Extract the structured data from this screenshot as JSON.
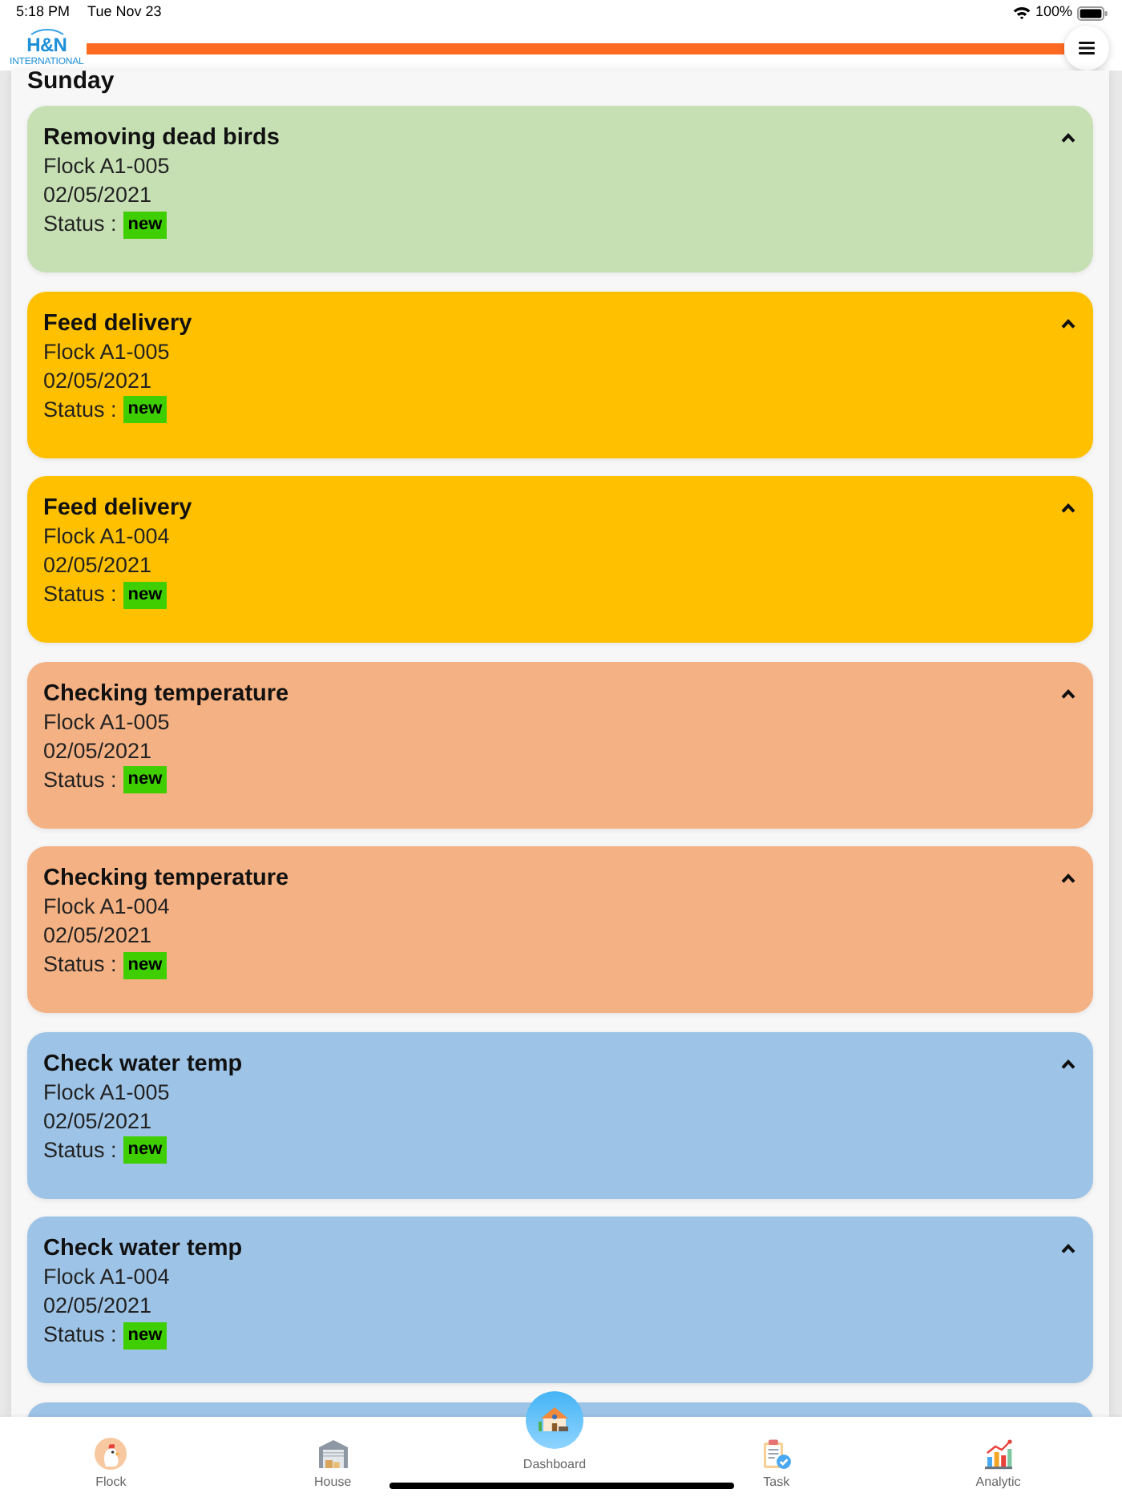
{
  "status_bar": {
    "time": "5:18 PM",
    "date": "Tue Nov 23",
    "battery": "100%"
  },
  "header": {
    "logo": "H&N",
    "logo_subtitle": "INTERNATIONAL"
  },
  "day": "Sunday",
  "cards": [
    {
      "title": "Removing dead birds",
      "flock": "Flock A1-005",
      "date": "02/05/2021",
      "status_label": "Status :",
      "status": "new",
      "color": "#c6e0b4",
      "expanded": true
    },
    {
      "title": "Feed delivery",
      "flock": "Flock A1-005",
      "date": "02/05/2021",
      "status_label": "Status :",
      "status": "new",
      "color": "#ffc000",
      "expanded": true
    },
    {
      "title": "Feed delivery",
      "flock": "Flock A1-004",
      "date": "02/05/2021",
      "status_label": "Status :",
      "status": "new",
      "color": "#ffc000",
      "expanded": true
    },
    {
      "title": "Checking temperature",
      "flock": "Flock A1-005",
      "date": "02/05/2021",
      "status_label": "Status :",
      "status": "new",
      "color": "#f4b183",
      "expanded": true
    },
    {
      "title": "Checking temperature",
      "flock": "Flock A1-004",
      "date": "02/05/2021",
      "status_label": "Status :",
      "status": "new",
      "color": "#f4b183",
      "expanded": true
    },
    {
      "title": "Check water temp",
      "flock": "Flock A1-005",
      "date": "02/05/2021",
      "status_label": "Status :",
      "status": "new",
      "color": "#9dc3e6",
      "expanded": true
    },
    {
      "title": "Check water temp",
      "flock": "Flock A1-004",
      "date": "02/05/2021",
      "status_label": "Status :",
      "status": "new",
      "color": "#9dc3e6",
      "expanded": true
    },
    {
      "color": "#9dc3e6"
    }
  ],
  "tab_bar": [
    {
      "label": "Flock",
      "kind": "tab"
    },
    {
      "label": "House",
      "kind": "tab"
    },
    {
      "label": "Dashboard",
      "kind": "center"
    },
    {
      "label": "Task",
      "kind": "tab"
    },
    {
      "label": "Analytic",
      "kind": "tab"
    }
  ]
}
